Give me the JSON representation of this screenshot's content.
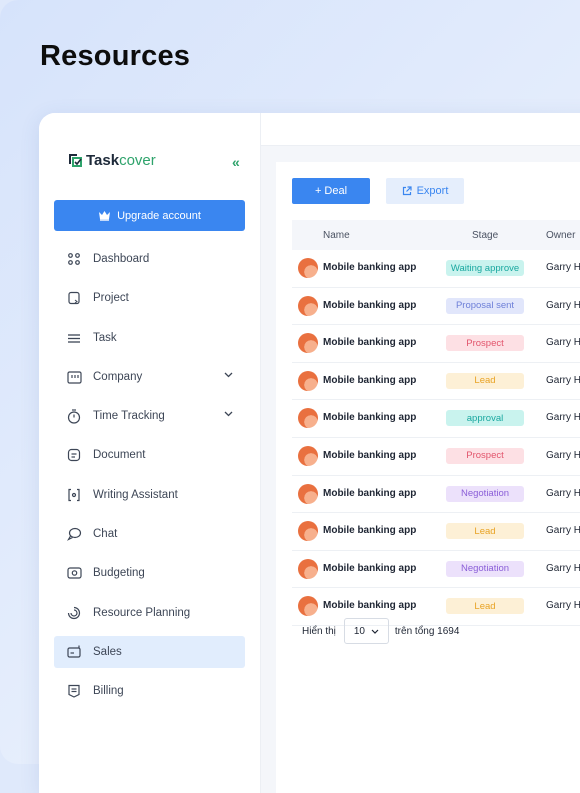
{
  "page": {
    "heading": "Resources"
  },
  "sidebar": {
    "logo": {
      "name_part1": "Task",
      "name_part2": "cover"
    },
    "collapse_glyph": "«",
    "upgrade_label": "Upgrade account",
    "items": [
      {
        "label": "Dashboard",
        "icon": "dashboard-icon"
      },
      {
        "label": "Project",
        "icon": "project-icon"
      },
      {
        "label": "Task",
        "icon": "task-icon"
      },
      {
        "label": "Company",
        "icon": "company-icon",
        "expandable": true
      },
      {
        "label": "Time Tracking",
        "icon": "timer-icon",
        "expandable": true
      },
      {
        "label": "Document",
        "icon": "document-icon"
      },
      {
        "label": "Writing Assistant",
        "icon": "writing-assistant-icon"
      },
      {
        "label": "Chat",
        "icon": "chat-icon"
      },
      {
        "label": "Budgeting",
        "icon": "budgeting-icon"
      },
      {
        "label": "Resource Planning",
        "icon": "resource-planning-icon"
      },
      {
        "label": "Sales",
        "icon": "sales-icon",
        "active": true
      },
      {
        "label": "Billing",
        "icon": "billing-icon"
      }
    ]
  },
  "toolbar": {
    "deal_label": "+ Deal",
    "export_label": "Export"
  },
  "table": {
    "columns": {
      "name": "Name",
      "stage": "Stage",
      "owner": "Owner"
    },
    "rows": [
      {
        "name": "Mobile banking app",
        "stage": "Waiting approve",
        "owner": "Garry H"
      },
      {
        "name": "Mobile banking app",
        "stage": "Proposal sent",
        "owner": "Garry H"
      },
      {
        "name": "Mobile banking app",
        "stage": "Prospect",
        "owner": "Garry H"
      },
      {
        "name": "Mobile banking app",
        "stage": "Lead",
        "owner": "Garry H"
      },
      {
        "name": "Mobile banking app",
        "stage": "approval",
        "owner": "Garry H"
      },
      {
        "name": "Mobile banking app",
        "stage": "Prospect",
        "owner": "Garry H"
      },
      {
        "name": "Mobile banking app",
        "stage": "Negotiation",
        "owner": "Garry H"
      },
      {
        "name": "Mobile banking app",
        "stage": "Lead",
        "owner": "Garry H"
      },
      {
        "name": "Mobile banking app",
        "stage": "Negotiation",
        "owner": "Garry H"
      },
      {
        "name": "Mobile banking app",
        "stage": "Lead",
        "owner": "Garry H"
      }
    ]
  },
  "stage_colors": {
    "Waiting approve": {
      "bg": "#c9f3ee",
      "fg": "#1aa8a0"
    },
    "approval": {
      "bg": "#c9f3ee",
      "fg": "#1aa8a0"
    },
    "Proposal sent": {
      "bg": "#e1e6fb",
      "fg": "#6d7fd8"
    },
    "Prospect": {
      "bg": "#fde0e4",
      "fg": "#e2556c"
    },
    "Lead": {
      "bg": "#fdf0d6",
      "fg": "#e8a325"
    },
    "Negotiation": {
      "bg": "#ece1fb",
      "fg": "#8b5fd8"
    }
  },
  "pagination": {
    "show_label": "Hiển thị",
    "page_size": "10",
    "total_label": "trên tổng 1694"
  }
}
